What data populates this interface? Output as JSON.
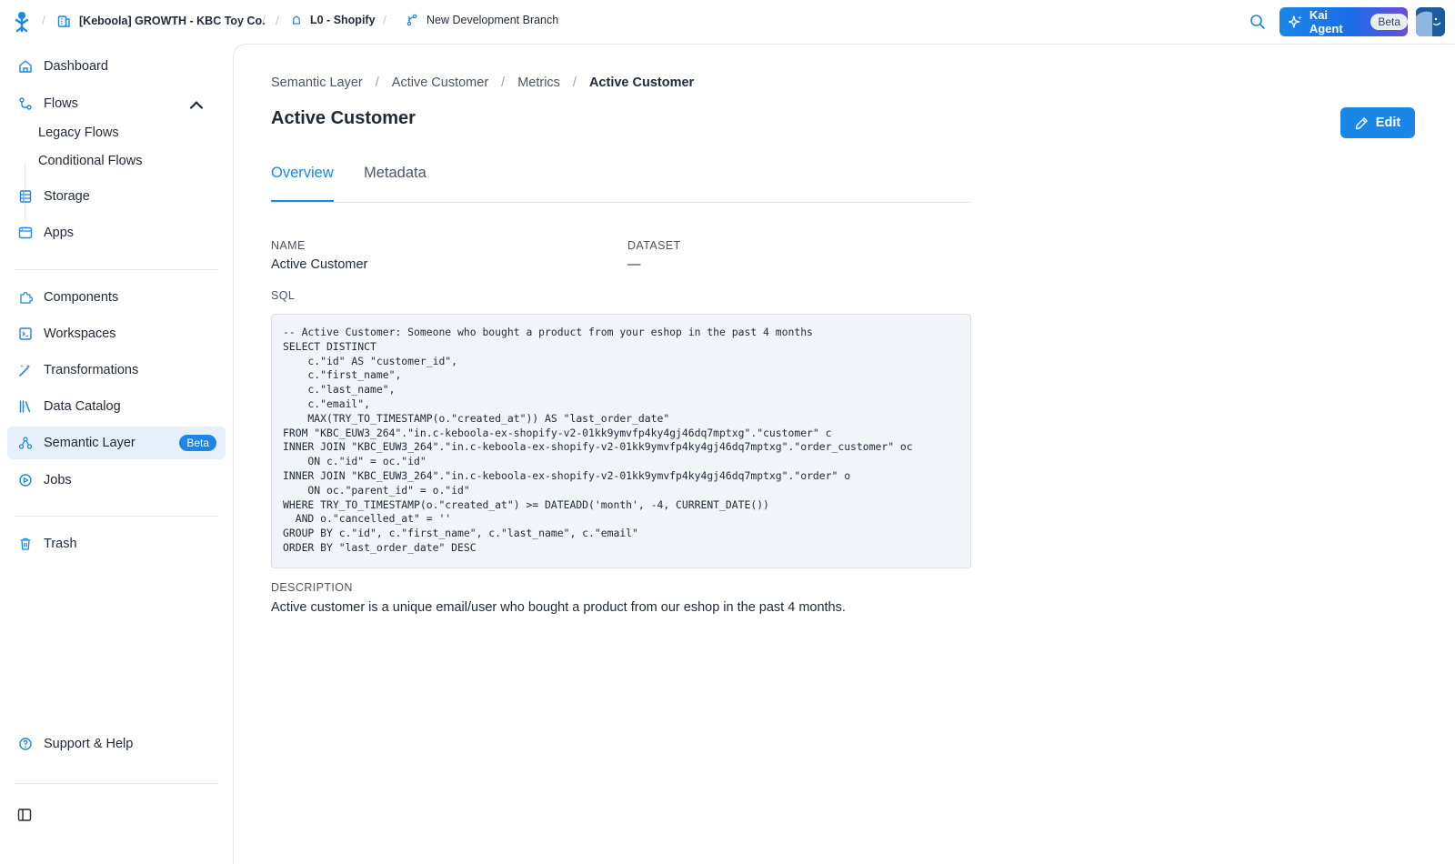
{
  "topbar": {
    "project": "[Keboola] GROWTH - KBC Toy Co.",
    "config": "L0 - Shopify",
    "branch": "New Development Branch",
    "kai_label": "Kai Agent",
    "kai_badge": "Beta"
  },
  "sidebar": {
    "dashboard": "Dashboard",
    "flows": "Flows",
    "legacy_flows": "Legacy Flows",
    "conditional_flows": "Conditional Flows",
    "storage": "Storage",
    "apps": "Apps",
    "components": "Components",
    "workspaces": "Workspaces",
    "transformations": "Transformations",
    "data_catalog": "Data Catalog",
    "semantic_layer": "Semantic Layer",
    "semantic_layer_badge": "Beta",
    "jobs": "Jobs",
    "trash": "Trash",
    "support": "Support & Help"
  },
  "breadcrumb": {
    "items": [
      "Semantic Layer",
      "Active Customer",
      "Metrics"
    ],
    "current": "Active Customer",
    "separator": "/"
  },
  "page": {
    "title": "Active Customer",
    "edit_label": "Edit"
  },
  "tabs": {
    "overview": "Overview",
    "metadata": "Metadata"
  },
  "fields": {
    "name_label": "NAME",
    "name_value": "Active Customer",
    "dataset_label": "DATASET",
    "dataset_value": "—",
    "sql_label": "SQL",
    "sql_value": "-- Active Customer: Someone who bought a product from your eshop in the past 4 months\nSELECT DISTINCT\n    c.\"id\" AS \"customer_id\",\n    c.\"first_name\",\n    c.\"last_name\",\n    c.\"email\",\n    MAX(TRY_TO_TIMESTAMP(o.\"created_at\")) AS \"last_order_date\"\nFROM \"KBC_EUW3_264\".\"in.c-keboola-ex-shopify-v2-01kk9ymvfp4ky4gj46dq7mptxg\".\"customer\" c\nINNER JOIN \"KBC_EUW3_264\".\"in.c-keboola-ex-shopify-v2-01kk9ymvfp4ky4gj46dq7mptxg\".\"order_customer\" oc\n    ON c.\"id\" = oc.\"id\"\nINNER JOIN \"KBC_EUW3_264\".\"in.c-keboola-ex-shopify-v2-01kk9ymvfp4ky4gj46dq7mptxg\".\"order\" o\n    ON oc.\"parent_id\" = o.\"id\"\nWHERE TRY_TO_TIMESTAMP(o.\"created_at\") >= DATEADD('month', -4, CURRENT_DATE())\n  AND o.\"cancelled_at\" = ''\nGROUP BY c.\"id\", c.\"first_name\", c.\"last_name\", c.\"email\"\nORDER BY \"last_order_date\" DESC",
    "description_label": "DESCRIPTION",
    "description_value": "Active customer is a unique email/user who bought a product from our eshop in the past 4 months."
  },
  "colors": {
    "accent": "#1a86e8",
    "active_nav_bg": "#e7effa"
  }
}
